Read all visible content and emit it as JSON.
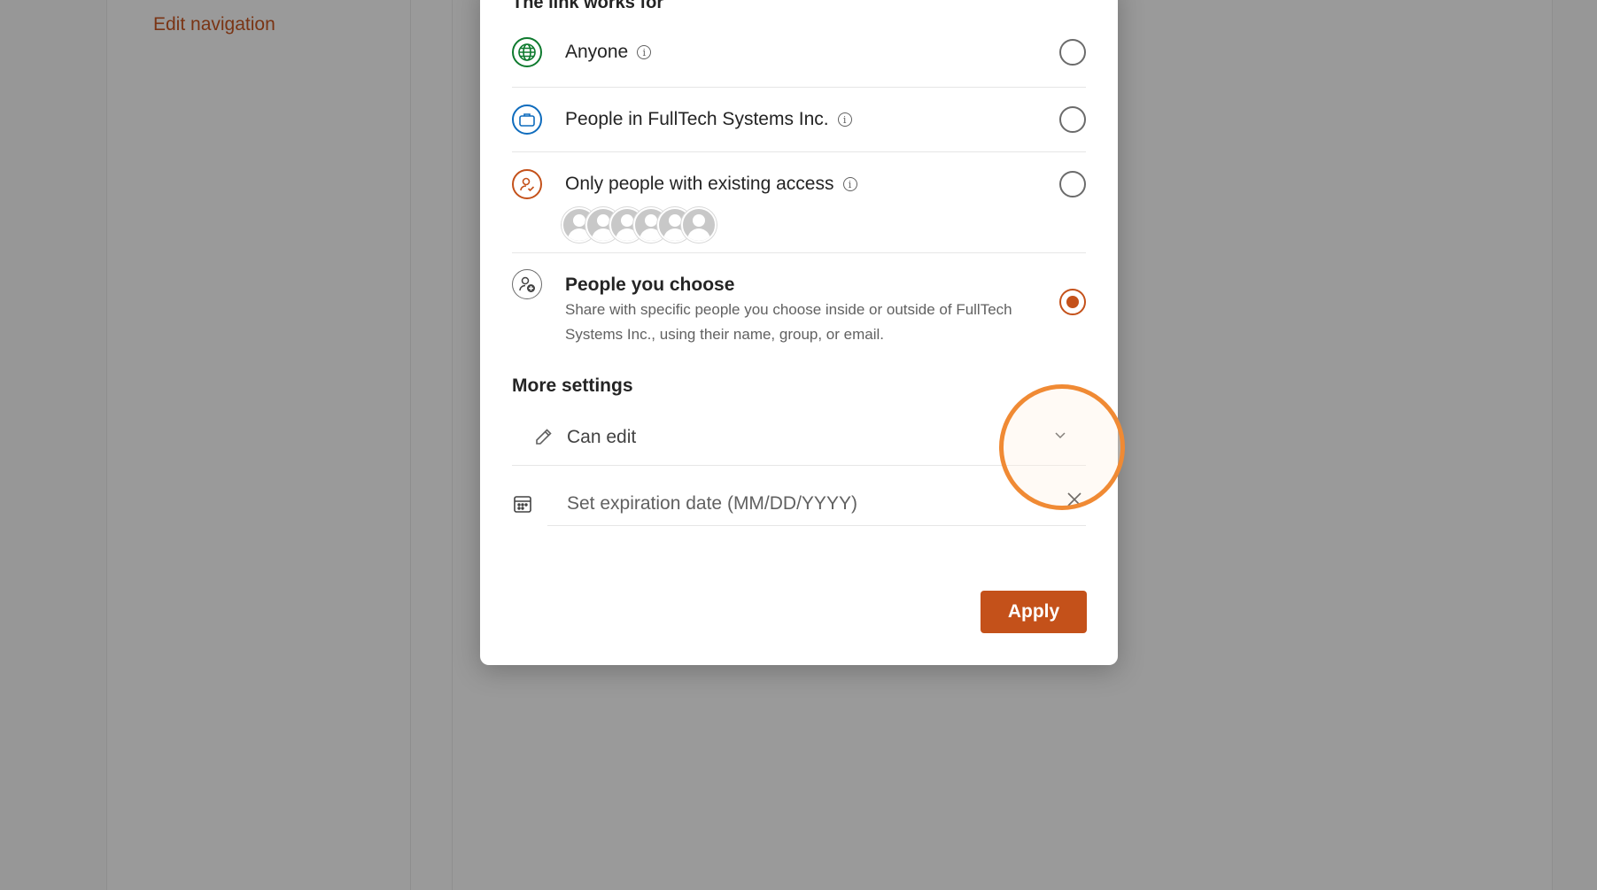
{
  "background": {
    "nav_link": "Edit navigation"
  },
  "dialog": {
    "heading": "The link works for",
    "options": [
      {
        "id": "anyone",
        "label": "Anyone",
        "info": true,
        "selected": false,
        "icon": "globe-icon",
        "icon_color": "#0e7a2e"
      },
      {
        "id": "org",
        "label": "People in FullTech Systems Inc.",
        "info": true,
        "selected": false,
        "icon": "briefcase-icon",
        "icon_color": "#0f6cbd"
      },
      {
        "id": "existing",
        "label": "Only people with existing access",
        "info": true,
        "selected": false,
        "icon": "person-check-icon",
        "icon_color": "#c4511a"
      },
      {
        "id": "choose",
        "label": "People you choose",
        "description": "Share with specific people you choose inside or outside of FullTech Systems Inc., using their name, group, or email.",
        "selected": true,
        "icon": "person-add-icon",
        "icon_color": "#424242"
      }
    ],
    "more_settings": {
      "heading": "More settings",
      "permission": "Can edit",
      "expiration_placeholder": "Set expiration date (MM/DD/YYYY)"
    },
    "apply_label": "Apply"
  },
  "colors": {
    "accent": "#c4511a",
    "click_ring": "#f08a34"
  }
}
